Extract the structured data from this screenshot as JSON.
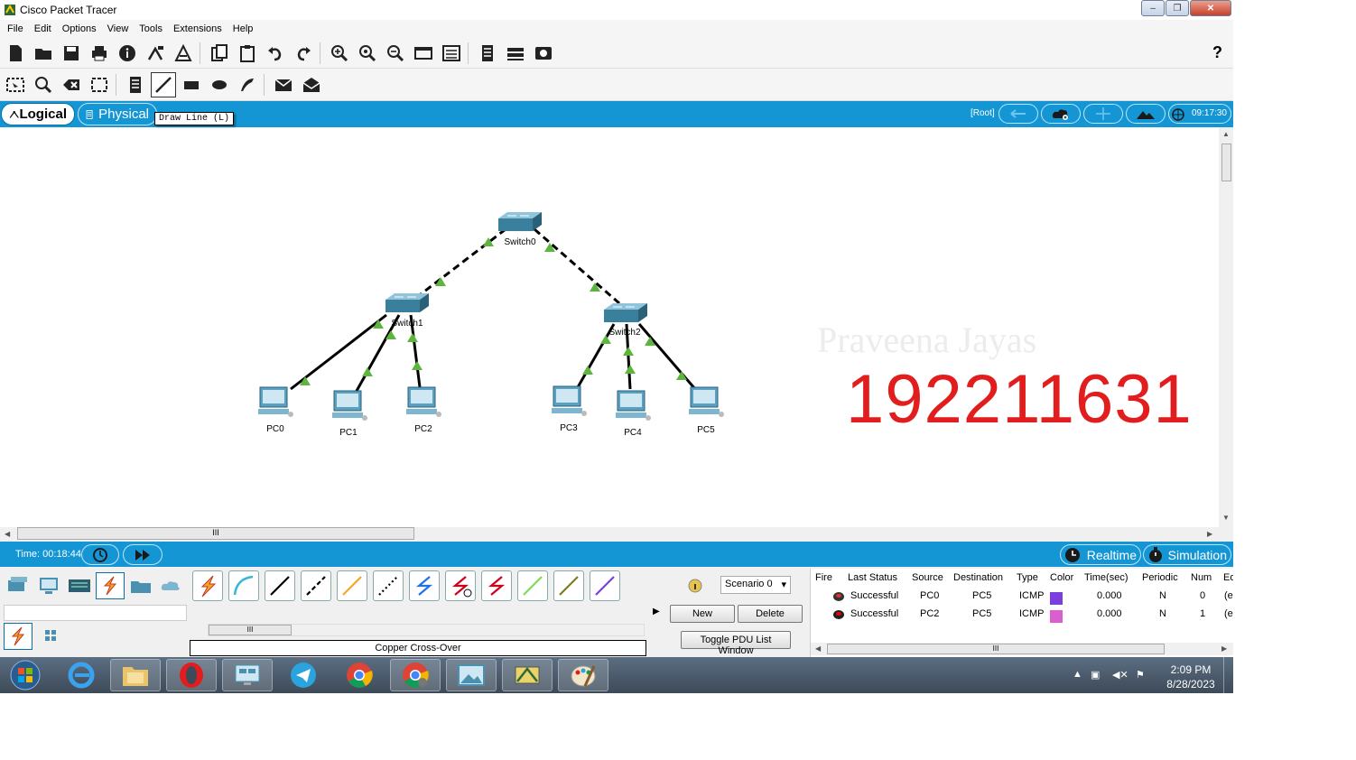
{
  "window": {
    "title": "Cisco Packet Tracer",
    "close": "✕",
    "minimize": "–",
    "maximize": "❐"
  },
  "menu": [
    "File",
    "Edit",
    "Options",
    "View",
    "Tools",
    "Extensions",
    "Help"
  ],
  "toolbar": {
    "help": "?"
  },
  "tabs": {
    "logical": "Logical",
    "physical": "Physical"
  },
  "tooltip": "Draw Line (L)",
  "tabstrip": {
    "root": "[Root]",
    "clock": "09:17:30"
  },
  "devices": {
    "switches": [
      "Switch0",
      "Switch1",
      "Switch2"
    ],
    "pcs": [
      "PC0",
      "PC1",
      "PC2",
      "PC3",
      "PC4",
      "PC5"
    ]
  },
  "overlay": {
    "faint_text": "Praveena Jayas",
    "number": "192211631"
  },
  "scroll": {
    "grip": "III"
  },
  "timebar": {
    "time": "Time: 00:18:44",
    "realtime": "Realtime",
    "simulation": "Simulation"
  },
  "bottom": {
    "connection_label": "Copper Cross-Over"
  },
  "scenario": {
    "select": "Scenario 0",
    "new": "New",
    "delete": "Delete",
    "toggle": "Toggle PDU List Window"
  },
  "pdu": {
    "headers": [
      "Fire",
      "Last Status",
      "Source",
      "Destination",
      "Type",
      "Color",
      "Time(sec)",
      "Periodic",
      "Num",
      "Ed"
    ],
    "rows": [
      {
        "status": "Successful",
        "source": "PC0",
        "destination": "PC5",
        "type": "ICMP",
        "color": "#7b3fe0",
        "time": "0.000",
        "periodic": "N",
        "num": "0",
        "edit": "(e"
      },
      {
        "status": "Successful",
        "source": "PC2",
        "destination": "PC5",
        "type": "ICMP",
        "color": "#d95fcf",
        "time": "0.000",
        "periodic": "N",
        "num": "1",
        "edit": "(e"
      }
    ]
  },
  "taskbar": {
    "time": "2:09 PM",
    "date": "8/28/2023"
  },
  "colors": {
    "accent_blue": "#1596d4",
    "link_green": "#5cb53c",
    "number_red": "#e11d1d"
  }
}
